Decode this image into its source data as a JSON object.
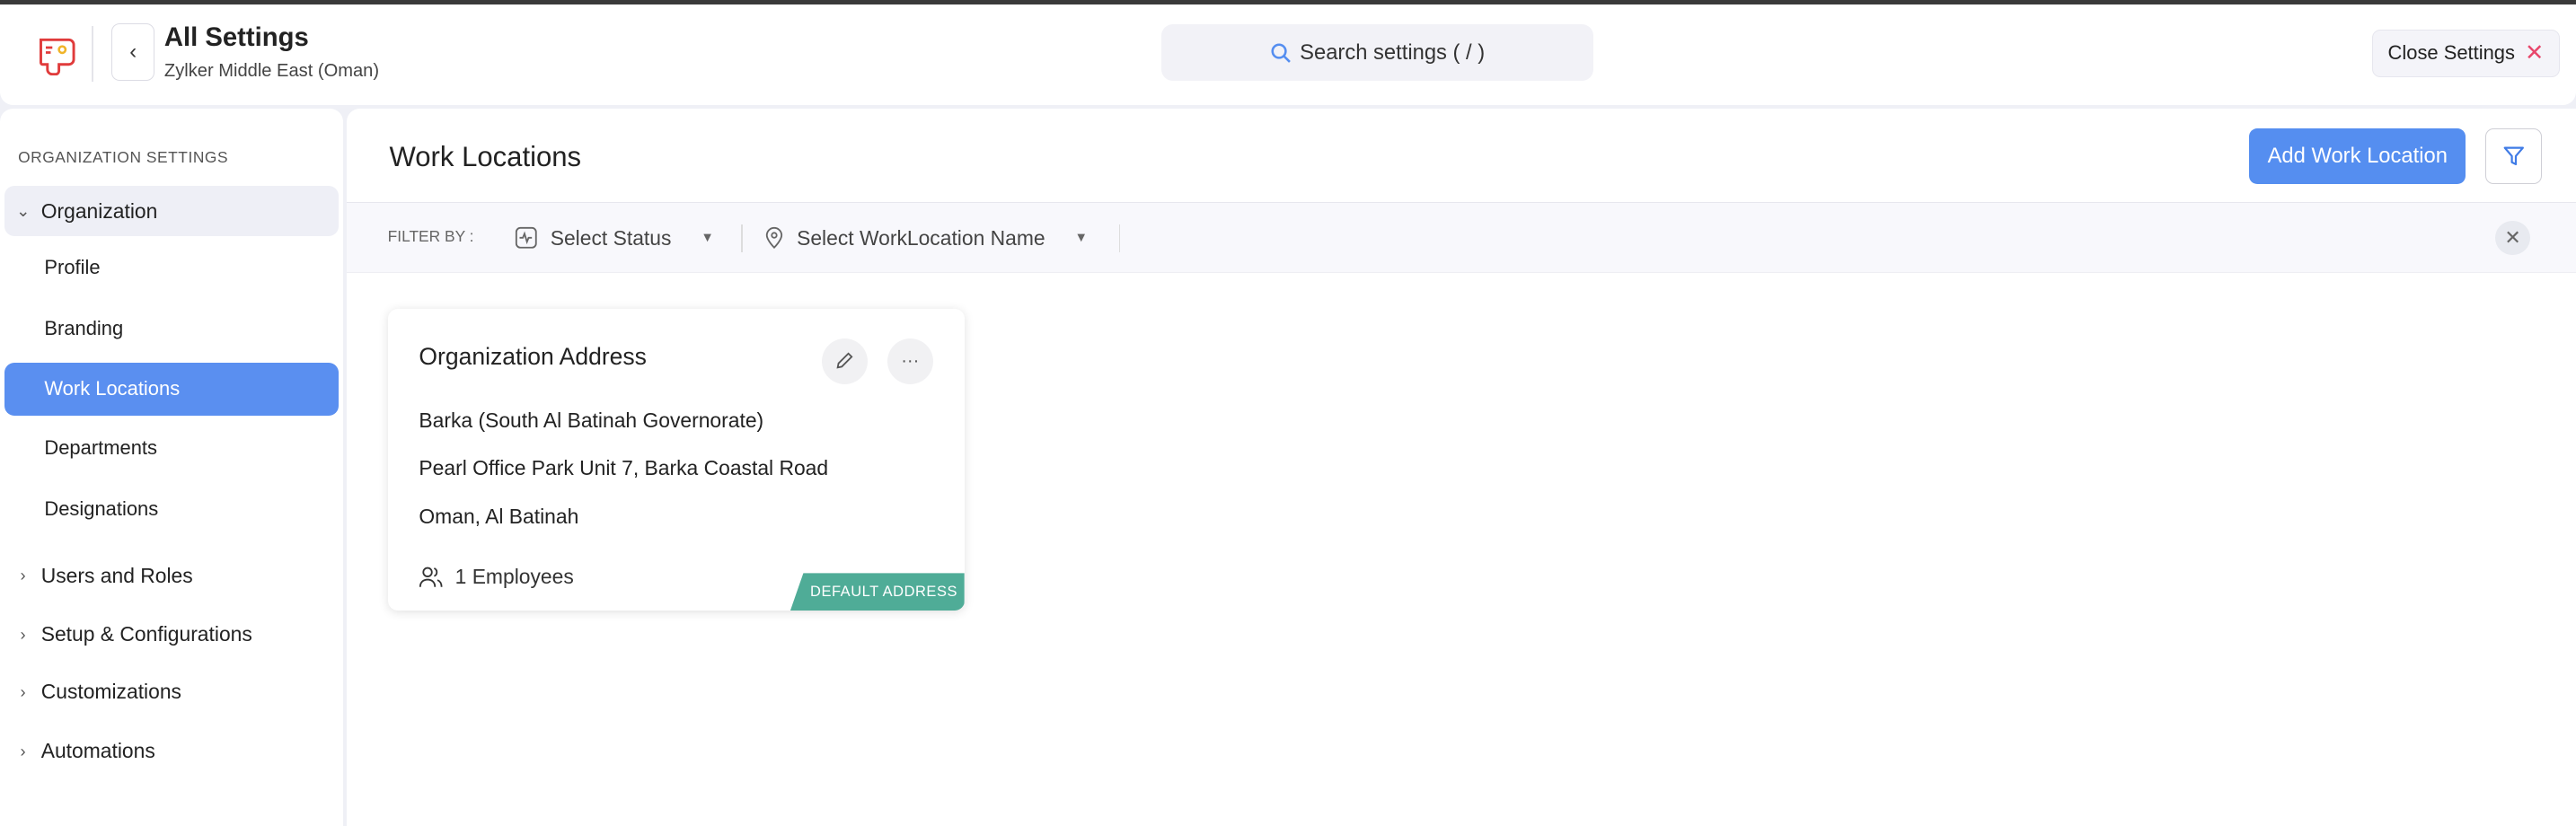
{
  "header": {
    "title": "All Settings",
    "subtitle": "Zylker Middle East (Oman)",
    "search_placeholder": "Search settings ( / )",
    "close_label": "Close Settings"
  },
  "sidebar": {
    "section": "ORGANIZATION SETTINGS",
    "organization": {
      "label": "Organization",
      "children": [
        "Profile",
        "Branding",
        "Work Locations",
        "Departments",
        "Designations"
      ]
    },
    "groups": [
      "Users and Roles",
      "Setup & Configurations",
      "Customizations",
      "Automations"
    ]
  },
  "main": {
    "title": "Work Locations",
    "add_button": "Add Work Location",
    "filter": {
      "label": "FILTER BY :",
      "status_placeholder": "Select Status",
      "name_placeholder": "Select WorkLocation Name"
    },
    "cards": [
      {
        "title": "Organization Address",
        "lines": [
          "Barka (South Al Batinah Governorate)",
          "Pearl Office Park Unit 7, Barka Coastal Road",
          "Oman, Al Batinah"
        ],
        "employees": "1 Employees",
        "badge": "DEFAULT ADDRESS"
      }
    ]
  },
  "colors": {
    "accent": "#558ef0",
    "badge": "#4fac97",
    "close_x": "#e8466b",
    "logo": "#e03b3b"
  }
}
